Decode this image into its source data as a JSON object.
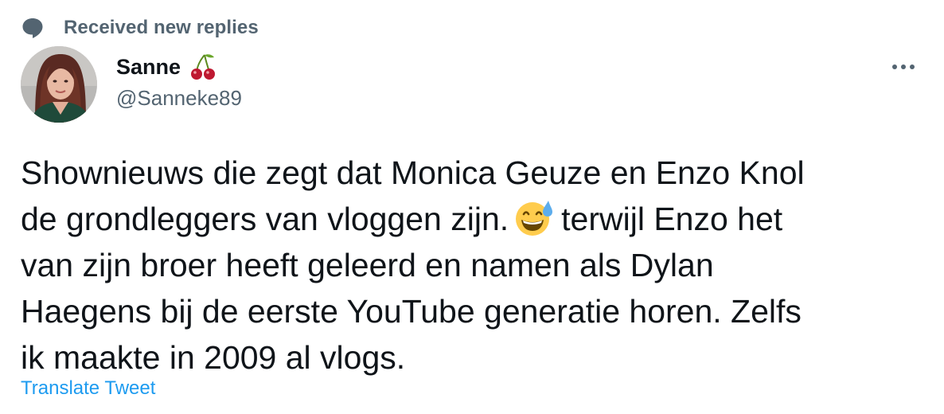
{
  "context": {
    "icon": "speech-bubble-icon",
    "label": "Received new replies"
  },
  "author": {
    "display_name": "Sanne",
    "name_emoji": "cherries-emoji",
    "handle": "@Sanneke89",
    "avatar": "avatar-photo"
  },
  "tweet": {
    "line1": "Shownieuws die zegt dat Monica Geuze en Enzo Knol",
    "line2a": "de grondleggers van vloggen zijn.",
    "inline_emoji": "grinning-sweat-emoji",
    "line2b": "terwijl Enzo het",
    "line3": "van zijn broer heeft geleerd en namen als Dylan",
    "line4": "Haegens bij de eerste YouTube generatie horen. Zelfs",
    "line5": "ik maakte in 2009 al vlogs."
  },
  "actions": {
    "translate_label": "Translate Tweet",
    "more_icon": "more-dots-icon"
  },
  "colors": {
    "text_primary": "#0f1419",
    "text_secondary": "#536471",
    "link": "#1d9bf0"
  }
}
